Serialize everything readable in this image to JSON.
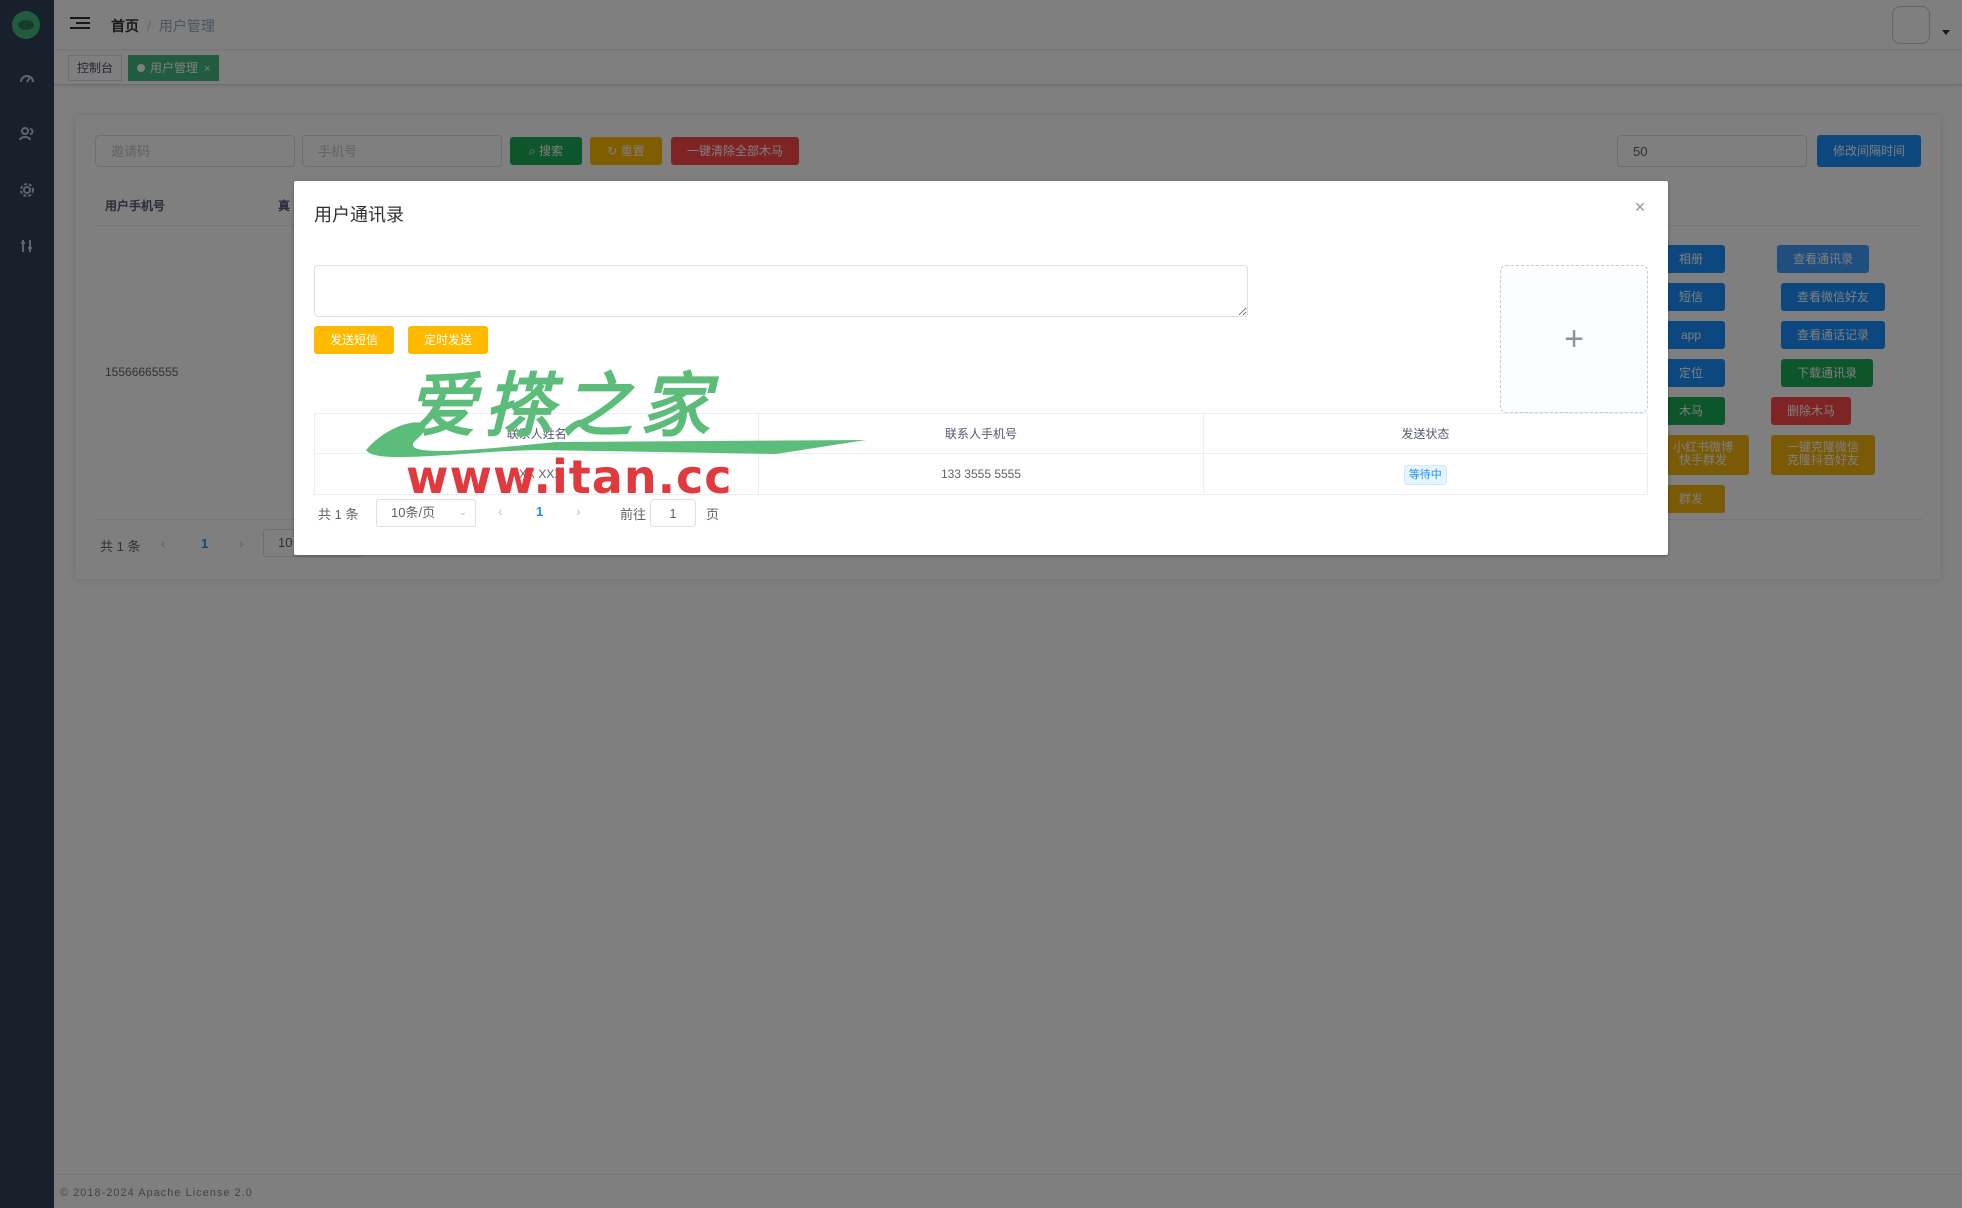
{
  "navbar": {
    "breadcrumb_home": "首页",
    "breadcrumb_sep": "/",
    "breadcrumb_current": "用户管理"
  },
  "tags": [
    {
      "label": "控制台",
      "active": false
    },
    {
      "label": "用户管理",
      "active": true,
      "close": "×"
    }
  ],
  "search": {
    "invite_placeholder": "邀请码",
    "phone_placeholder": "手机号",
    "search_label": "搜索",
    "reset_label": "重置",
    "clear_all_label": "一键清除全部木马",
    "interval_value": "50",
    "interval_button": "修改间隔时间"
  },
  "table": {
    "col_phone": "用户手机号",
    "col_name_partial": "真",
    "row_phone": "15566665555",
    "actions": {
      "album": "相册",
      "sms": "短信",
      "app": "app",
      "location": "定位",
      "trojan": "木马",
      "xhs_line1": "小红书微博",
      "xhs_line2": "快手群发",
      "group": "群发",
      "view_contacts": "查看通讯录",
      "view_wechat": "查看微信好友",
      "view_calls": "查看通话记录",
      "download_contacts": "下载通讯录",
      "delete_trojan": "删除木马",
      "clone_line1": "一键克隆微信",
      "clone_line2": "克隆抖音好友"
    }
  },
  "main_pager": {
    "total": "共 1 条",
    "prev": "‹",
    "page": "1",
    "next": "›",
    "size_partial": "10"
  },
  "dialog": {
    "title": "用户通讯录",
    "close": "×",
    "send_sms": "发送短信",
    "timed_send": "定时发送",
    "upload_plus": "+",
    "columns": [
      "联系人姓名",
      "联系人手机号",
      "发送状态"
    ],
    "rows": [
      {
        "name": "XXX XXX",
        "phone": "133 3555 5555",
        "status": "等待中"
      }
    ],
    "pager": {
      "total": "共 1 条",
      "page_size": "10条/页",
      "prev": "‹",
      "page": "1",
      "next": "›",
      "goto": "前往",
      "goto_value": "1",
      "page_unit": "页"
    }
  },
  "watermark": {
    "cn": "爱搽之家",
    "url": "www.itan.cc"
  },
  "footer": {
    "text": "© 2018-2024 Apache License 2.0"
  },
  "colors": {
    "sidebar": "#304156",
    "accent_green": "#42b983",
    "primary": "#1890ff",
    "warning": "#ffba00",
    "danger": "#ff4949"
  }
}
